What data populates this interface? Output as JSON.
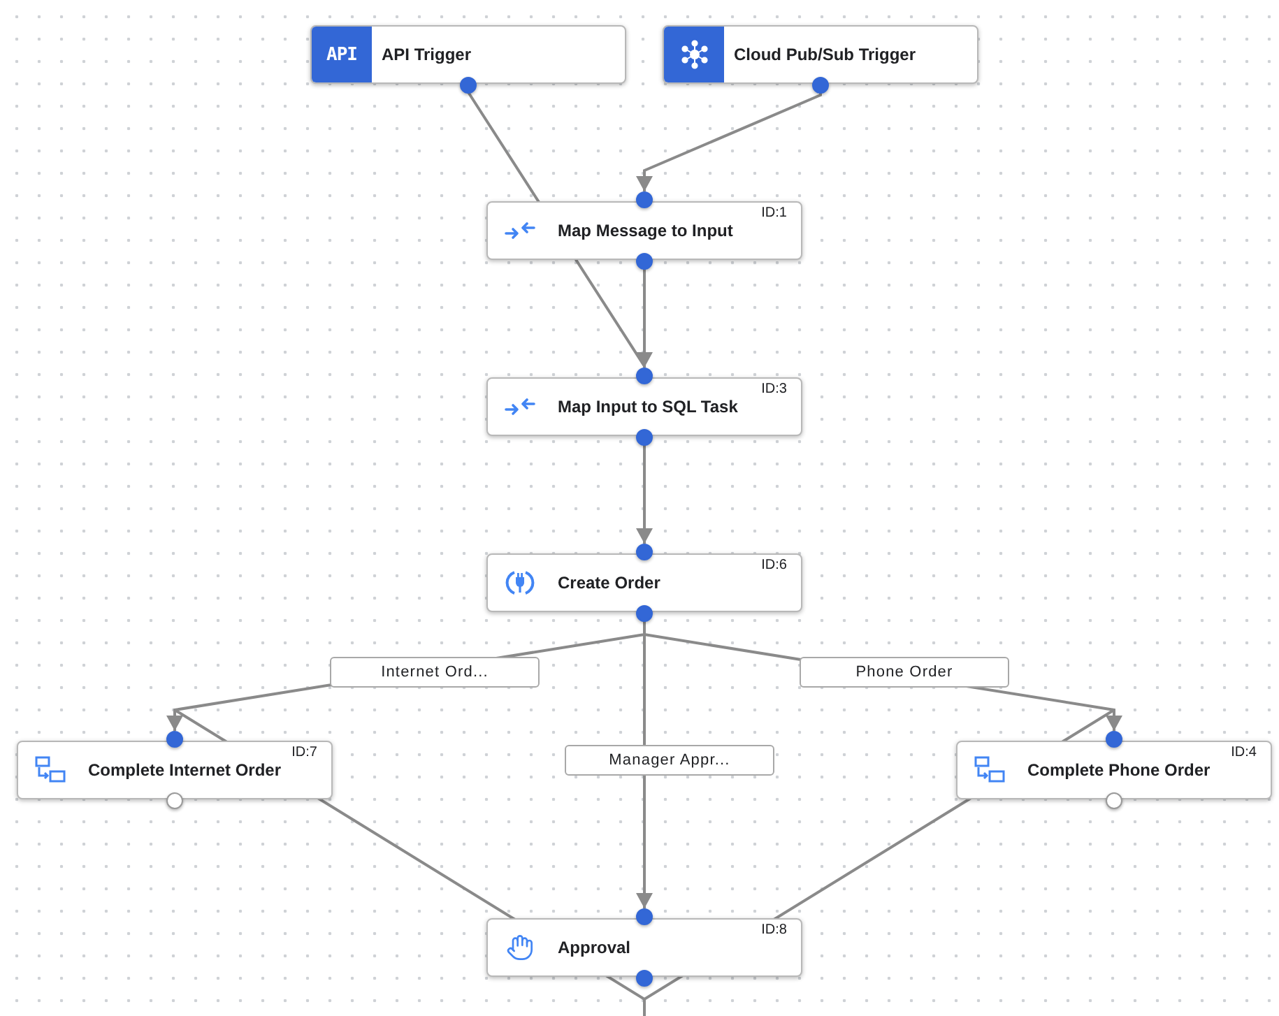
{
  "nodes": [
    {
      "kind": "api_trigger",
      "title": "API Trigger",
      "icon_text": "API",
      "has_input": false,
      "output_connected": true
    },
    {
      "kind": "pubsub_trigger",
      "title": "Cloud Pub/Sub Trigger",
      "has_input": false,
      "output_connected": true
    },
    {
      "kind": "mapping",
      "title": "Map Message to Input",
      "id_label": "ID:1",
      "has_input": true,
      "output_connected": true
    },
    {
      "kind": "mapping",
      "title": "Map Input to SQL Task",
      "id_label": "ID:3",
      "has_input": true,
      "output_connected": true
    },
    {
      "kind": "connector",
      "title": "Create Order",
      "id_label": "ID:6",
      "has_input": true,
      "output_connected": true
    },
    {
      "kind": "subflow",
      "title": "Complete Internet Order",
      "id_label": "ID:7",
      "has_input": true,
      "output_connected": false
    },
    {
      "kind": "subflow",
      "title": "Complete Phone Order",
      "id_label": "ID:4",
      "has_input": true,
      "output_connected": false
    },
    {
      "kind": "approval",
      "title": "Approval",
      "id_label": "ID:8",
      "has_input": true,
      "output_connected": true
    }
  ],
  "edge_labels": [
    {
      "text": "Internet Ord..."
    },
    {
      "text": "Phone Order"
    },
    {
      "text": "Manager Appr..."
    }
  ]
}
